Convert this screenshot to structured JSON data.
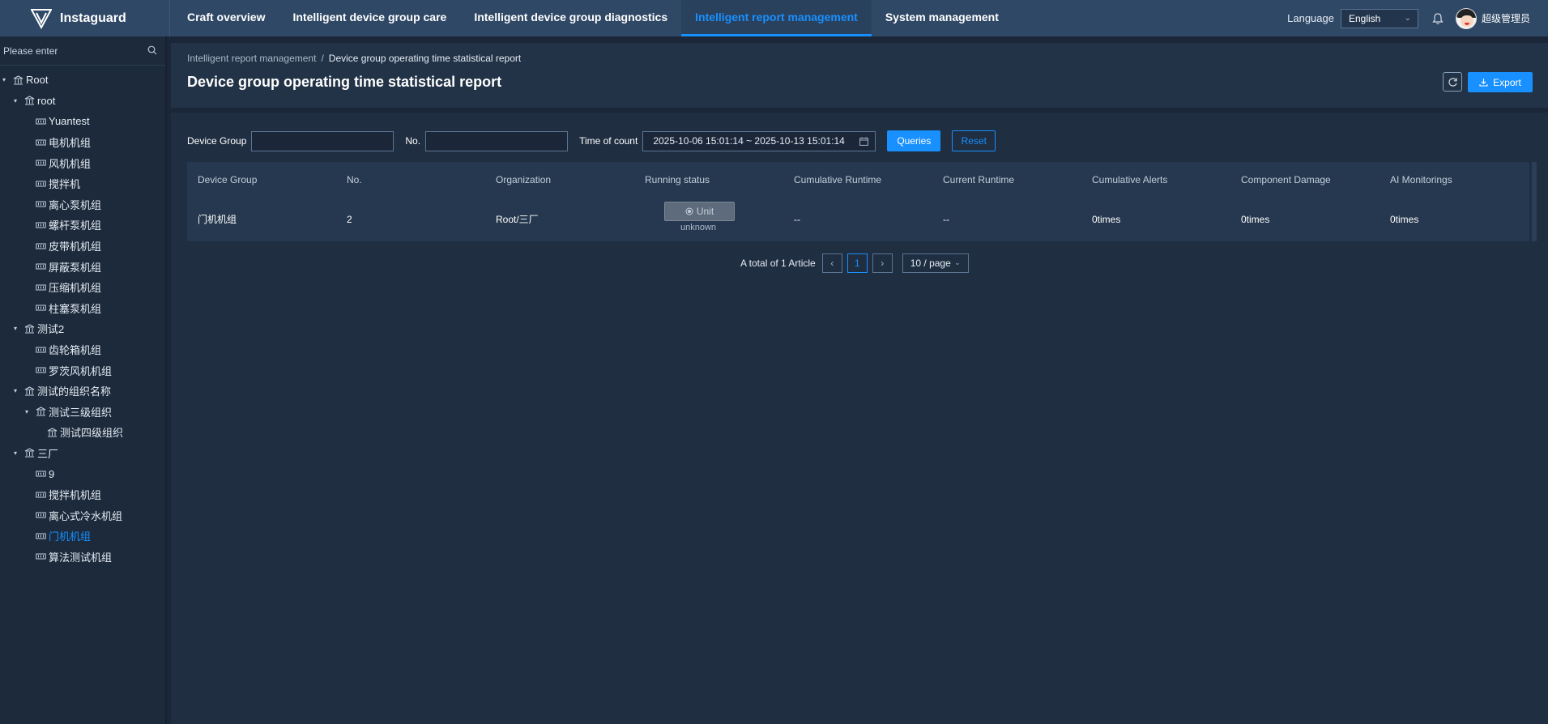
{
  "app": {
    "name": "Instaguard"
  },
  "nav": {
    "items": [
      {
        "label": "Craft overview"
      },
      {
        "label": "Intelligent device group care"
      },
      {
        "label": "Intelligent device group diagnostics"
      },
      {
        "label": "Intelligent report management"
      },
      {
        "label": "System management"
      }
    ],
    "active_index": 3
  },
  "topbar": {
    "language_label": "Language",
    "language_value": "English",
    "user_name": "超级管理员"
  },
  "sidebar": {
    "search_placeholder": "Please enter",
    "tree": [
      {
        "label": "Root"
      },
      {
        "label": "root"
      },
      {
        "label": "Yuantest"
      },
      {
        "label": "电机机组"
      },
      {
        "label": "风机机组"
      },
      {
        "label": "搅拌机"
      },
      {
        "label": "离心泵机组"
      },
      {
        "label": "螺杆泵机组"
      },
      {
        "label": "皮带机机组"
      },
      {
        "label": "屏蔽泵机组"
      },
      {
        "label": "压缩机机组"
      },
      {
        "label": "柱塞泵机组"
      },
      {
        "label": "测试2"
      },
      {
        "label": "齿轮箱机组"
      },
      {
        "label": "罗茨风机机组"
      },
      {
        "label": "测试的组织名称"
      },
      {
        "label": "测试三级组织"
      },
      {
        "label": "测试四级组织"
      },
      {
        "label": "三厂"
      },
      {
        "label": "9"
      },
      {
        "label": "搅拌机机组"
      },
      {
        "label": "离心式冷水机组"
      },
      {
        "label": "门机机组"
      },
      {
        "label": "算法测试机组"
      }
    ],
    "selected": "门机机组"
  },
  "breadcrumb": {
    "parent": "Intelligent report management",
    "separator": "/",
    "current": "Device group operating time statistical report"
  },
  "page_title": "Device group operating time statistical report",
  "toolbar": {
    "export_label": "Export"
  },
  "filters": {
    "device_group_label": "Device Group",
    "device_group_value": "",
    "no_label": "No.",
    "no_value": "",
    "time_label": "Time of count",
    "time_range": "2025-10-06 15:01:14 ~ 2025-10-13 15:01:14",
    "query_label": "Queries",
    "reset_label": "Reset"
  },
  "table": {
    "columns": [
      "Device Group",
      "No.",
      "Organization",
      "Running status",
      "Cumulative Runtime",
      "Current Runtime",
      "Cumulative Alerts",
      "Component Damage",
      "AI Monitorings"
    ],
    "rows": [
      {
        "device_group": "门机机组",
        "no": "2",
        "organization": "Root/三厂",
        "status_label": "Unit",
        "status_sub": "unknown",
        "cumulative_runtime": "--",
        "current_runtime": "--",
        "cumulative_alerts": "0times",
        "component_damage": "0times",
        "ai_monitorings": "0times"
      }
    ]
  },
  "pagination": {
    "total_text": "A total of 1 Article",
    "current_page": "1",
    "page_size": "10 / page"
  },
  "colors": {
    "accent": "#1890ff",
    "topbar": "#2f4866",
    "background": "#1b2738"
  }
}
